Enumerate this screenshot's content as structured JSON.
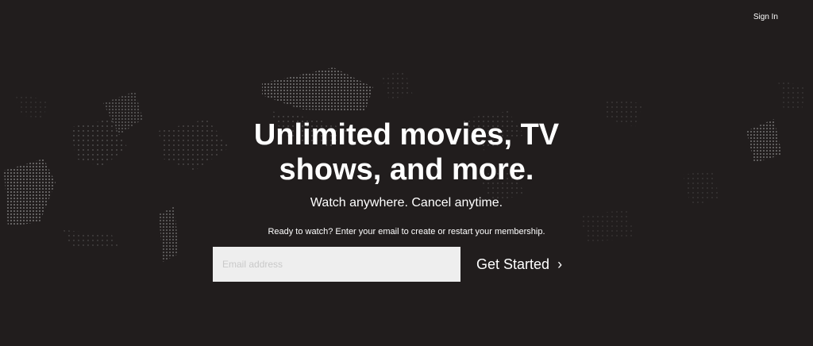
{
  "header": {
    "signin_label": "Sign In"
  },
  "hero": {
    "headline_line1": "Unlimited movies, TV",
    "headline_line2": "shows, and more.",
    "subheadline": "Watch anywhere. Cancel anytime.",
    "cta_text": "Ready to watch? Enter your email to create or restart your membership.",
    "email_placeholder": "Email address",
    "email_value": "",
    "get_started_label": "Get Started",
    "get_started_icon": "chevron-right-icon"
  },
  "colors": {
    "background": "#211d1d",
    "text": "#ffffff",
    "input_bg": "#eeeeee",
    "dots": "#a8a8a8"
  }
}
